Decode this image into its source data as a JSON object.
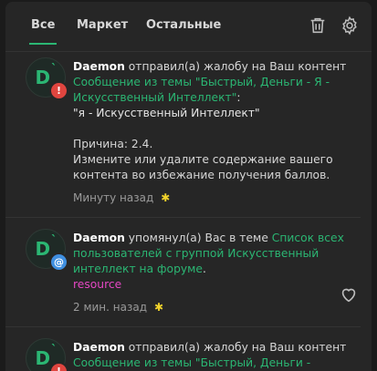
{
  "tabs": {
    "all": "Все",
    "market": "Маркет",
    "other": "Остальные"
  },
  "icons": {
    "trash": "trash-icon",
    "settings": "gear-icon",
    "heart": "heart-icon"
  },
  "colors": {
    "accent": "#2bb673",
    "warn": "#e0453f",
    "mention": "#3f8fe0",
    "star": "#f2d32b",
    "tag": "#e547c4"
  },
  "notifications": [
    {
      "avatar_letter": "D",
      "badge": "!",
      "user": "Daemon",
      "action": " отправил(а) жалобу на Ваш контент",
      "link": "Сообщение из темы \"Быстрый, Деньги - Я - Искусственный Интеллект\"",
      "after_link": ":",
      "quote": "\"я - Искусственный Интеллект\"",
      "reason": "Причина: 2.4.",
      "detail": "Измените или удалите содержание вашего контента во избежание получения баллов.",
      "time": "Минуту назад"
    },
    {
      "avatar_letter": "D",
      "badge": "@",
      "user": "Daemon",
      "action": " упомянул(а) Вас в теме ",
      "link": "Список всех пользователей с группой Искусственный интеллект на форуме",
      "after_link": ".",
      "tag": "resource",
      "time": "2 мин. назад"
    },
    {
      "avatar_letter": "D",
      "badge": "!",
      "user": "Daemon",
      "action": " отправил(а) жалобу на Ваш контент",
      "link": "Сообщение из темы \"Быстрый, Деньги - Искусственный Интеллект Я или к тебе\""
    }
  ]
}
